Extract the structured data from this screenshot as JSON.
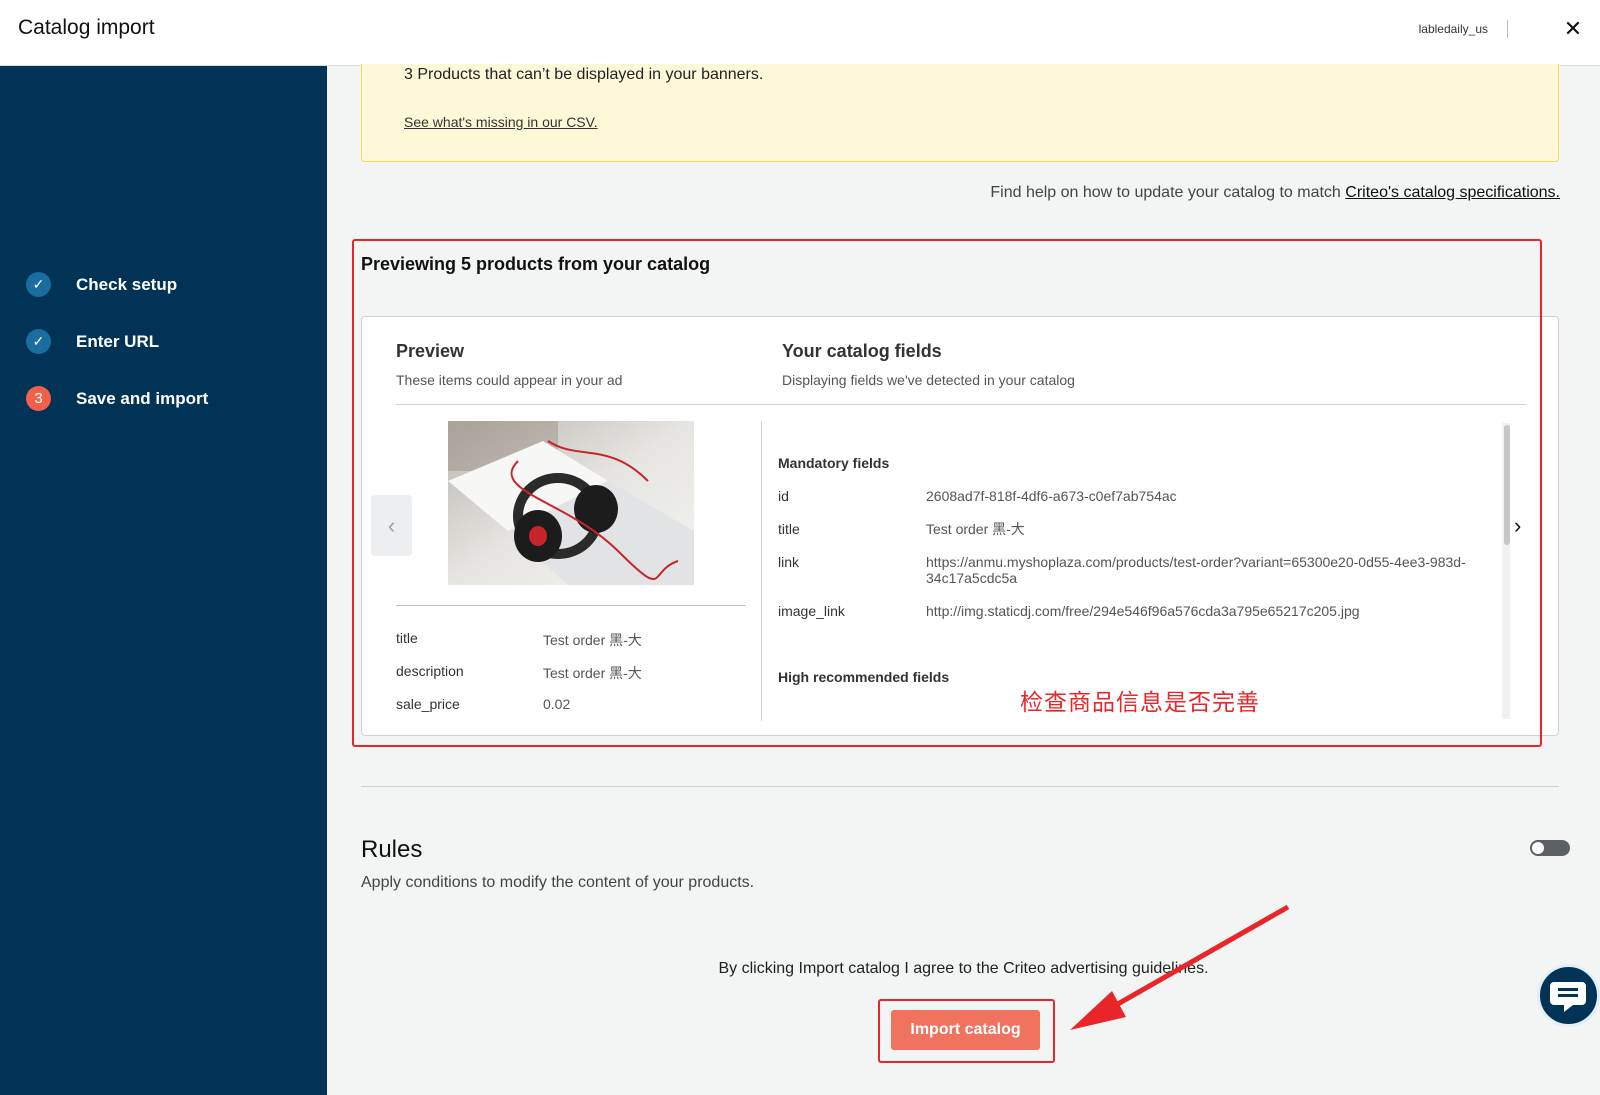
{
  "header": {
    "title": "Catalog import",
    "account": "labledaily_us",
    "close_icon": "close-icon"
  },
  "sidebar": {
    "steps": [
      {
        "marker": "✓",
        "label": "Check setup",
        "state": "done"
      },
      {
        "marker": "✓",
        "label": "Enter URL",
        "state": "done"
      },
      {
        "marker": "3",
        "label": "Save and import",
        "state": "current"
      }
    ]
  },
  "warning": {
    "text": "3 Products that can’t be displayed in your banners.",
    "link": "See what's missing in our CSV."
  },
  "help": {
    "text": "Find help on how to update your catalog to match",
    "link": "Criteo's catalog specifications."
  },
  "preview": {
    "title": "Previewing 5 products from your catalog",
    "col1_title": "Preview",
    "col1_sub": "These items could appear in your ad",
    "col2_title": "Your catalog fields",
    "col2_sub": "Displaying fields we've detected in your catalog",
    "product": [
      {
        "key": "title",
        "value": "Test order 黑-大"
      },
      {
        "key": "description",
        "value": "Test order 黑-大"
      },
      {
        "key": "sale_price",
        "value": "0.02"
      }
    ],
    "mandatory_title": "Mandatory fields",
    "mandatory": [
      {
        "key": "id",
        "value": "2608ad7f-818f-4df6-a673-c0ef7ab754ac"
      },
      {
        "key": "title",
        "value": "Test order 黑-大"
      },
      {
        "key": "link",
        "value": "https://anmu.myshoplaza.com/products/test-order?variant=65300e20-0d55-4ee3-983d-34c17a5cdc5a"
      },
      {
        "key": "image_link",
        "value": "http://img.staticdj.com/free/294e546f96a576cda3a795e65217c205.jpg"
      }
    ],
    "high_title": "High recommended fields"
  },
  "annotation": {
    "text": "检查商品信息是否完善",
    "color": "#e8262a"
  },
  "rules": {
    "title": "Rules",
    "subtitle": "Apply conditions to modify the content of your products.",
    "toggle_on": false
  },
  "footer": {
    "agree": "By clicking Import catalog I agree to the Criteo advertising guidelines.",
    "import_label": "Import catalog"
  },
  "colors": {
    "sidebar": "#003356",
    "accent": "#f0735f",
    "warning_bg": "#fdf9d8"
  }
}
